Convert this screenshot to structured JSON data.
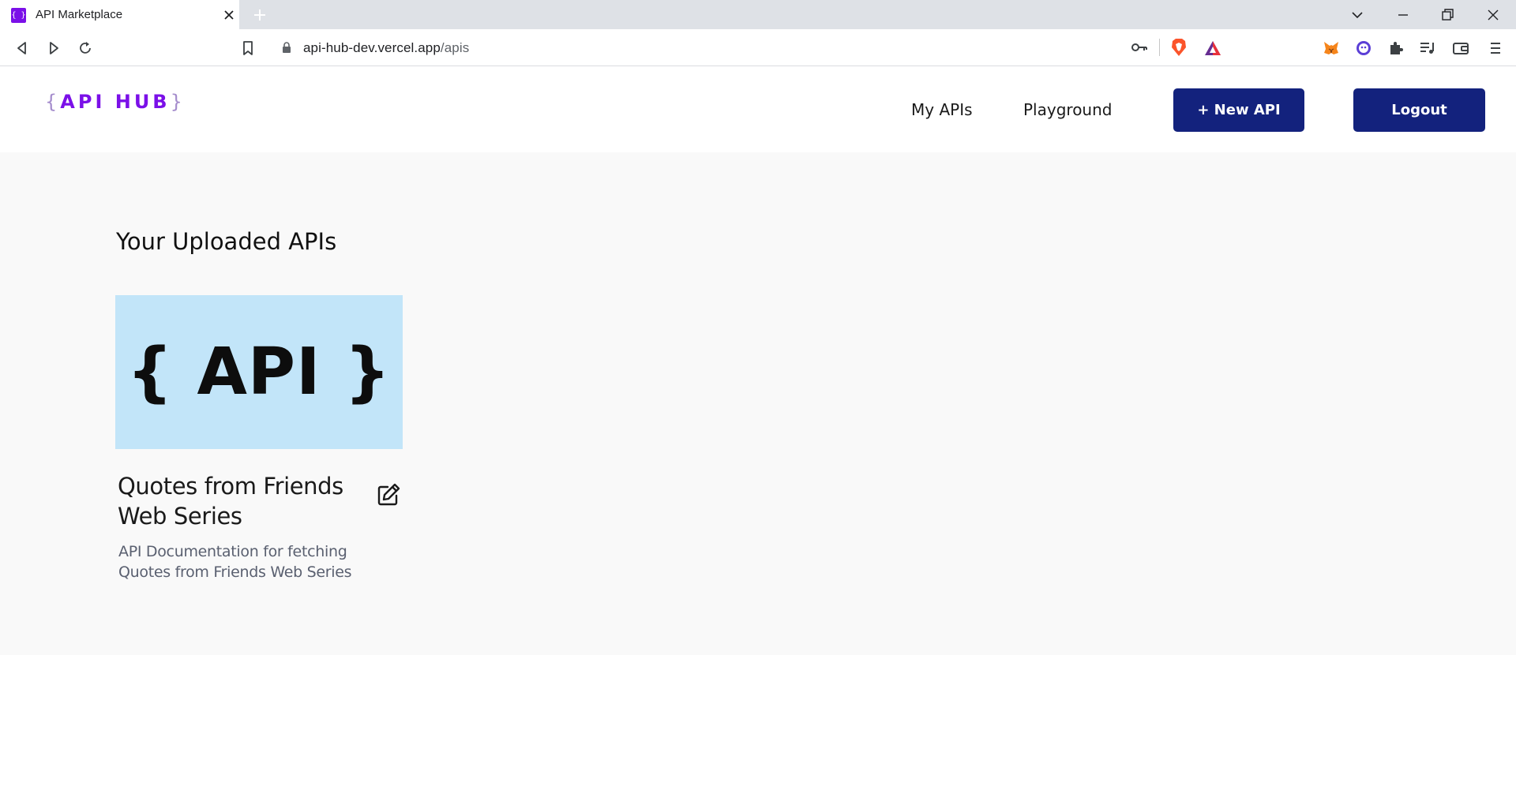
{
  "browser": {
    "tab_title": "API Marketplace",
    "tab_favicon": "{ }",
    "url_host": "api-hub-dev.vercel.app",
    "url_path": "/apis"
  },
  "header": {
    "logo_open": "{",
    "logo_text": "API HUB",
    "logo_close": "}",
    "nav_my_apis": "My APIs",
    "nav_playground": "Playground",
    "new_api_label": "+ New API",
    "logout_label": "Logout"
  },
  "main": {
    "page_title": "Your Uploaded APIs",
    "cards": [
      {
        "image_text": "{ API }",
        "title": "Quotes from Friends Web Series",
        "description": "API Documentation for fetching Quotes from Friends Web Series"
      }
    ]
  },
  "colors": {
    "accent": "#7b10e8",
    "button_bg": "#13227d",
    "card_image_bg": "#c2e5f9"
  }
}
